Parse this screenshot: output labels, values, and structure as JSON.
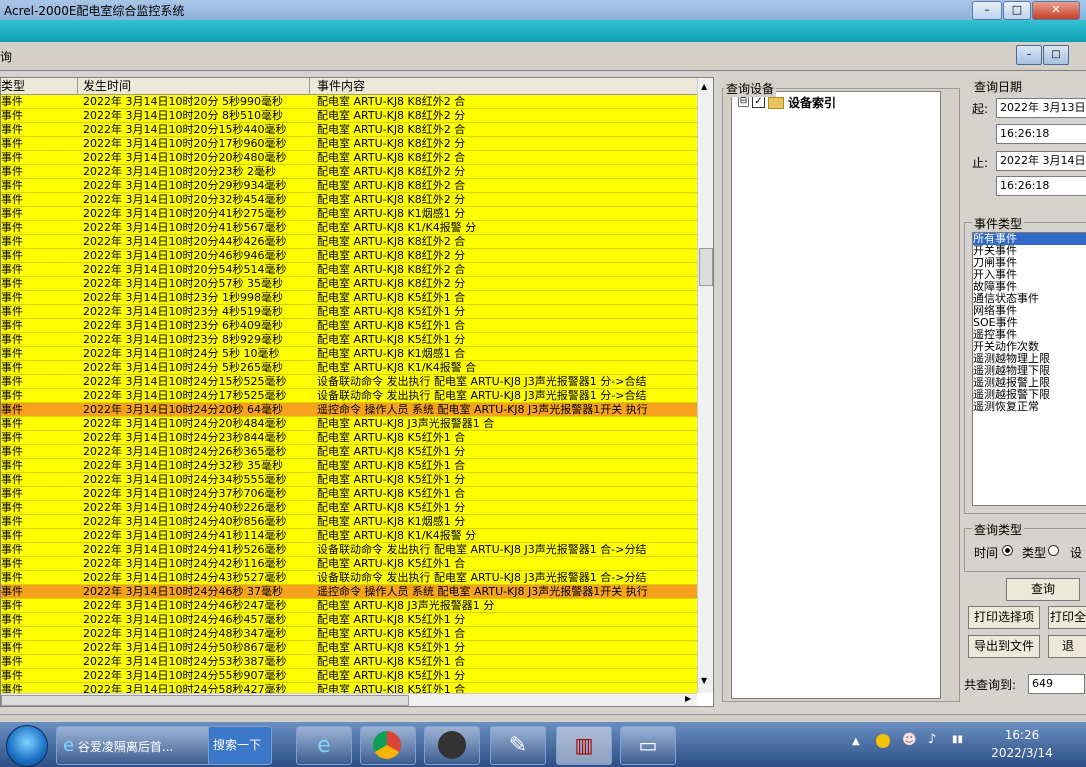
{
  "window": {
    "title": "Acrel-2000E配电室综合监控系统",
    "min": "–",
    "max": "□",
    "close": "✕"
  },
  "child": {
    "title": "询"
  },
  "table": {
    "headers": [
      "类型",
      "发生时间",
      "事件内容"
    ],
    "rows": [
      {
        "type": "事件",
        "time": "2022年 3月14日10时20分 5秒990毫秒",
        "content": "配电室 ARTU-KJ8 K8红外2 合",
        "hl": "y"
      },
      {
        "type": "事件",
        "time": "2022年 3月14日10时20分 8秒510毫秒",
        "content": "配电室 ARTU-KJ8 K8红外2 分",
        "hl": "y"
      },
      {
        "type": "事件",
        "time": "2022年 3月14日10时20分15秒440毫秒",
        "content": "配电室 ARTU-KJ8 K8红外2 合",
        "hl": "y"
      },
      {
        "type": "事件",
        "time": "2022年 3月14日10时20分17秒960毫秒",
        "content": "配电室 ARTU-KJ8 K8红外2 分",
        "hl": "y"
      },
      {
        "type": "事件",
        "time": "2022年 3月14日10时20分20秒480毫秒",
        "content": "配电室 ARTU-KJ8 K8红外2 合",
        "hl": "y"
      },
      {
        "type": "事件",
        "time": "2022年 3月14日10时20分23秒 2毫秒",
        "content": "配电室 ARTU-KJ8 K8红外2 分",
        "hl": "y"
      },
      {
        "type": "事件",
        "time": "2022年 3月14日10时20分29秒934毫秒",
        "content": "配电室 ARTU-KJ8 K8红外2 合",
        "hl": "y"
      },
      {
        "type": "事件",
        "time": "2022年 3月14日10时20分32秒454毫秒",
        "content": "配电室 ARTU-KJ8 K8红外2 分",
        "hl": "y"
      },
      {
        "type": "事件",
        "time": "2022年 3月14日10时20分41秒275毫秒",
        "content": "配电室 ARTU-KJ8 K1烟感1 分",
        "hl": "y"
      },
      {
        "type": "事件",
        "time": "2022年 3月14日10时20分41秒567毫秒",
        "content": "配电室 ARTU-KJ8 K1/K4报警 分",
        "hl": "y"
      },
      {
        "type": "事件",
        "time": "2022年 3月14日10时20分44秒426毫秒",
        "content": "配电室 ARTU-KJ8 K8红外2 合",
        "hl": "y"
      },
      {
        "type": "事件",
        "time": "2022年 3月14日10时20分46秒946毫秒",
        "content": "配电室 ARTU-KJ8 K8红外2 分",
        "hl": "y"
      },
      {
        "type": "事件",
        "time": "2022年 3月14日10时20分54秒514毫秒",
        "content": "配电室 ARTU-KJ8 K8红外2 合",
        "hl": "y"
      },
      {
        "type": "事件",
        "time": "2022年 3月14日10时20分57秒 35毫秒",
        "content": "配电室 ARTU-KJ8 K8红外2 分",
        "hl": "y"
      },
      {
        "type": "事件",
        "time": "2022年 3月14日10时23分 1秒998毫秒",
        "content": "配电室 ARTU-KJ8 K5红外1 合",
        "hl": "y"
      },
      {
        "type": "事件",
        "time": "2022年 3月14日10时23分 4秒519毫秒",
        "content": "配电室 ARTU-KJ8 K5红外1 分",
        "hl": "y"
      },
      {
        "type": "事件",
        "time": "2022年 3月14日10时23分 6秒409毫秒",
        "content": "配电室 ARTU-KJ8 K5红外1 合",
        "hl": "y"
      },
      {
        "type": "事件",
        "time": "2022年 3月14日10时23分 8秒929毫秒",
        "content": "配电室 ARTU-KJ8 K5红外1 分",
        "hl": "y"
      },
      {
        "type": "事件",
        "time": "2022年 3月14日10时24分 5秒 10毫秒",
        "content": "配电室 ARTU-KJ8 K1烟感1 合",
        "hl": "y"
      },
      {
        "type": "事件",
        "time": "2022年 3月14日10时24分 5秒265毫秒",
        "content": "配电室 ARTU-KJ8 K1/K4报警 合",
        "hl": "y"
      },
      {
        "type": "事件",
        "time": "2022年 3月14日10时24分15秒525毫秒",
        "content": "设备联动命令 发出执行 配电室 ARTU-KJ8 J3声光报警器1 分->合结",
        "hl": "y"
      },
      {
        "type": "事件",
        "time": "2022年 3月14日10时24分17秒525毫秒",
        "content": "设备联动命令 发出执行 配电室 ARTU-KJ8 J3声光报警器1 分->合结",
        "hl": "y"
      },
      {
        "type": "事件",
        "time": "2022年 3月14日10时24分20秒 64毫秒",
        "content": "遥控命令 操作人员 系统 配电室 ARTU-KJ8 J3声光报警器1开关 执行",
        "hl": "o"
      },
      {
        "type": "事件",
        "time": "2022年 3月14日10时24分20秒484毫秒",
        "content": "配电室 ARTU-KJ8 J3声光报警器1 合",
        "hl": "y"
      },
      {
        "type": "事件",
        "time": "2022年 3月14日10时24分23秒844毫秒",
        "content": "配电室 ARTU-KJ8 K5红外1 合",
        "hl": "y"
      },
      {
        "type": "事件",
        "time": "2022年 3月14日10时24分26秒365毫秒",
        "content": "配电室 ARTU-KJ8 K5红外1 分",
        "hl": "y"
      },
      {
        "type": "事件",
        "time": "2022年 3月14日10时24分32秒 35毫秒",
        "content": "配电室 ARTU-KJ8 K5红外1 合",
        "hl": "y"
      },
      {
        "type": "事件",
        "time": "2022年 3月14日10时24分34秒555毫秒",
        "content": "配电室 ARTU-KJ8 K5红外1 分",
        "hl": "y"
      },
      {
        "type": "事件",
        "time": "2022年 3月14日10时24分37秒706毫秒",
        "content": "配电室 ARTU-KJ8 K5红外1 合",
        "hl": "y"
      },
      {
        "type": "事件",
        "time": "2022年 3月14日10时24分40秒226毫秒",
        "content": "配电室 ARTU-KJ8 K5红外1 分",
        "hl": "y"
      },
      {
        "type": "事件",
        "time": "2022年 3月14日10时24分40秒856毫秒",
        "content": "配电室 ARTU-KJ8 K1烟感1 分",
        "hl": "y"
      },
      {
        "type": "事件",
        "time": "2022年 3月14日10时24分41秒114毫秒",
        "content": "配电室 ARTU-KJ8 K1/K4报警 分",
        "hl": "y"
      },
      {
        "type": "事件",
        "time": "2022年 3月14日10时24分41秒526毫秒",
        "content": "设备联动命令 发出执行 配电室 ARTU-KJ8 J3声光报警器1 合->分结",
        "hl": "y"
      },
      {
        "type": "事件",
        "time": "2022年 3月14日10时24分42秒116毫秒",
        "content": "配电室 ARTU-KJ8 K5红外1 合",
        "hl": "y"
      },
      {
        "type": "事件",
        "time": "2022年 3月14日10时24分43秒527毫秒",
        "content": "设备联动命令 发出执行 配电室 ARTU-KJ8 J3声光报警器1 合->分结",
        "hl": "y"
      },
      {
        "type": "事件",
        "time": "2022年 3月14日10时24分46秒 37毫秒",
        "content": "遥控命令 操作人员 系统 配电室 ARTU-KJ8 J3声光报警器1开关 执行",
        "hl": "o"
      },
      {
        "type": "事件",
        "time": "2022年 3月14日10时24分46秒247毫秒",
        "content": "配电室 ARTU-KJ8 J3声光报警器1 分",
        "hl": "y"
      },
      {
        "type": "事件",
        "time": "2022年 3月14日10时24分46秒457毫秒",
        "content": "配电室 ARTU-KJ8 K5红外1 分",
        "hl": "y"
      },
      {
        "type": "事件",
        "time": "2022年 3月14日10时24分48秒347毫秒",
        "content": "配电室 ARTU-KJ8 K5红外1 合",
        "hl": "y"
      },
      {
        "type": "事件",
        "time": "2022年 3月14日10时24分50秒867毫秒",
        "content": "配电室 ARTU-KJ8 K5红外1 分",
        "hl": "y"
      },
      {
        "type": "事件",
        "time": "2022年 3月14日10时24分53秒387毫秒",
        "content": "配电室 ARTU-KJ8 K5红外1 合",
        "hl": "y"
      },
      {
        "type": "事件",
        "time": "2022年 3月14日10时24分55秒907毫秒",
        "content": "配电室 ARTU-KJ8 K5红外1 分",
        "hl": "y"
      },
      {
        "type": "事件",
        "time": "2022年 3月14日10时24分58秒427毫秒",
        "content": "配电室 ARTU-KJ8 K5红外1 合",
        "hl": "y"
      },
      {
        "type": "事件",
        "time": "2022年 3月14日10时25分 0秒948毫秒",
        "content": "配电室 ARTU-KJ8 K5红外1 分",
        "hl": "y"
      },
      {
        "type": "事件",
        "time": "2022年 3月14日10时25分 9秒138毫秒",
        "content": "配电室 ARTU-KJ8 K5红外1 合",
        "hl": "y"
      },
      {
        "type": "事件",
        "time": "2022年 3月14日10时25分11秒658毫秒",
        "content": "配电室 ARTU-KJ8 K5红外1 分",
        "hl": "y"
      }
    ],
    "colors": {
      "yellow": "#ffff00",
      "orange": "#f6a21c"
    }
  },
  "device": {
    "group_label": "查询设备",
    "tree_root": "设备索引",
    "expand": "⊟",
    "check": "✓"
  },
  "query": {
    "date_label": "查询日期",
    "start_label": "起:",
    "start_date": "2022年 3月13日",
    "start_time": "16:26:18",
    "end_label": "止:",
    "end_date": "2022年 3月14日",
    "end_time": "16:26:18",
    "event_type_label": "事件类型",
    "event_types": [
      "所有事件",
      "开关事件",
      "刀闸事件",
      "开入事件",
      "故障事件",
      "通信状态事件",
      "网络事件",
      "SOE事件",
      "遥控事件",
      "开关动作次数",
      "遥测越物理上限",
      "遥测越物理下限",
      "遥测越报警上限",
      "遥测越报警下限",
      "遥测恢复正常"
    ],
    "query_type_label": "查询类型",
    "opt_time": "时间",
    "opt_type": "类型",
    "opt_dev": "设",
    "query_btn": "查询",
    "print_sel_btn": "打印选择项",
    "print_btn": "打印全",
    "export_btn": "导出到文件",
    "exit_btn": "退",
    "count_label": "共查询到:",
    "count_value": "649"
  },
  "taskbar": {
    "ie_item": "谷爱凌隔离后首...",
    "search_item": "搜索一下",
    "clock_time": "16:26",
    "clock_date": "2022/3/14"
  }
}
